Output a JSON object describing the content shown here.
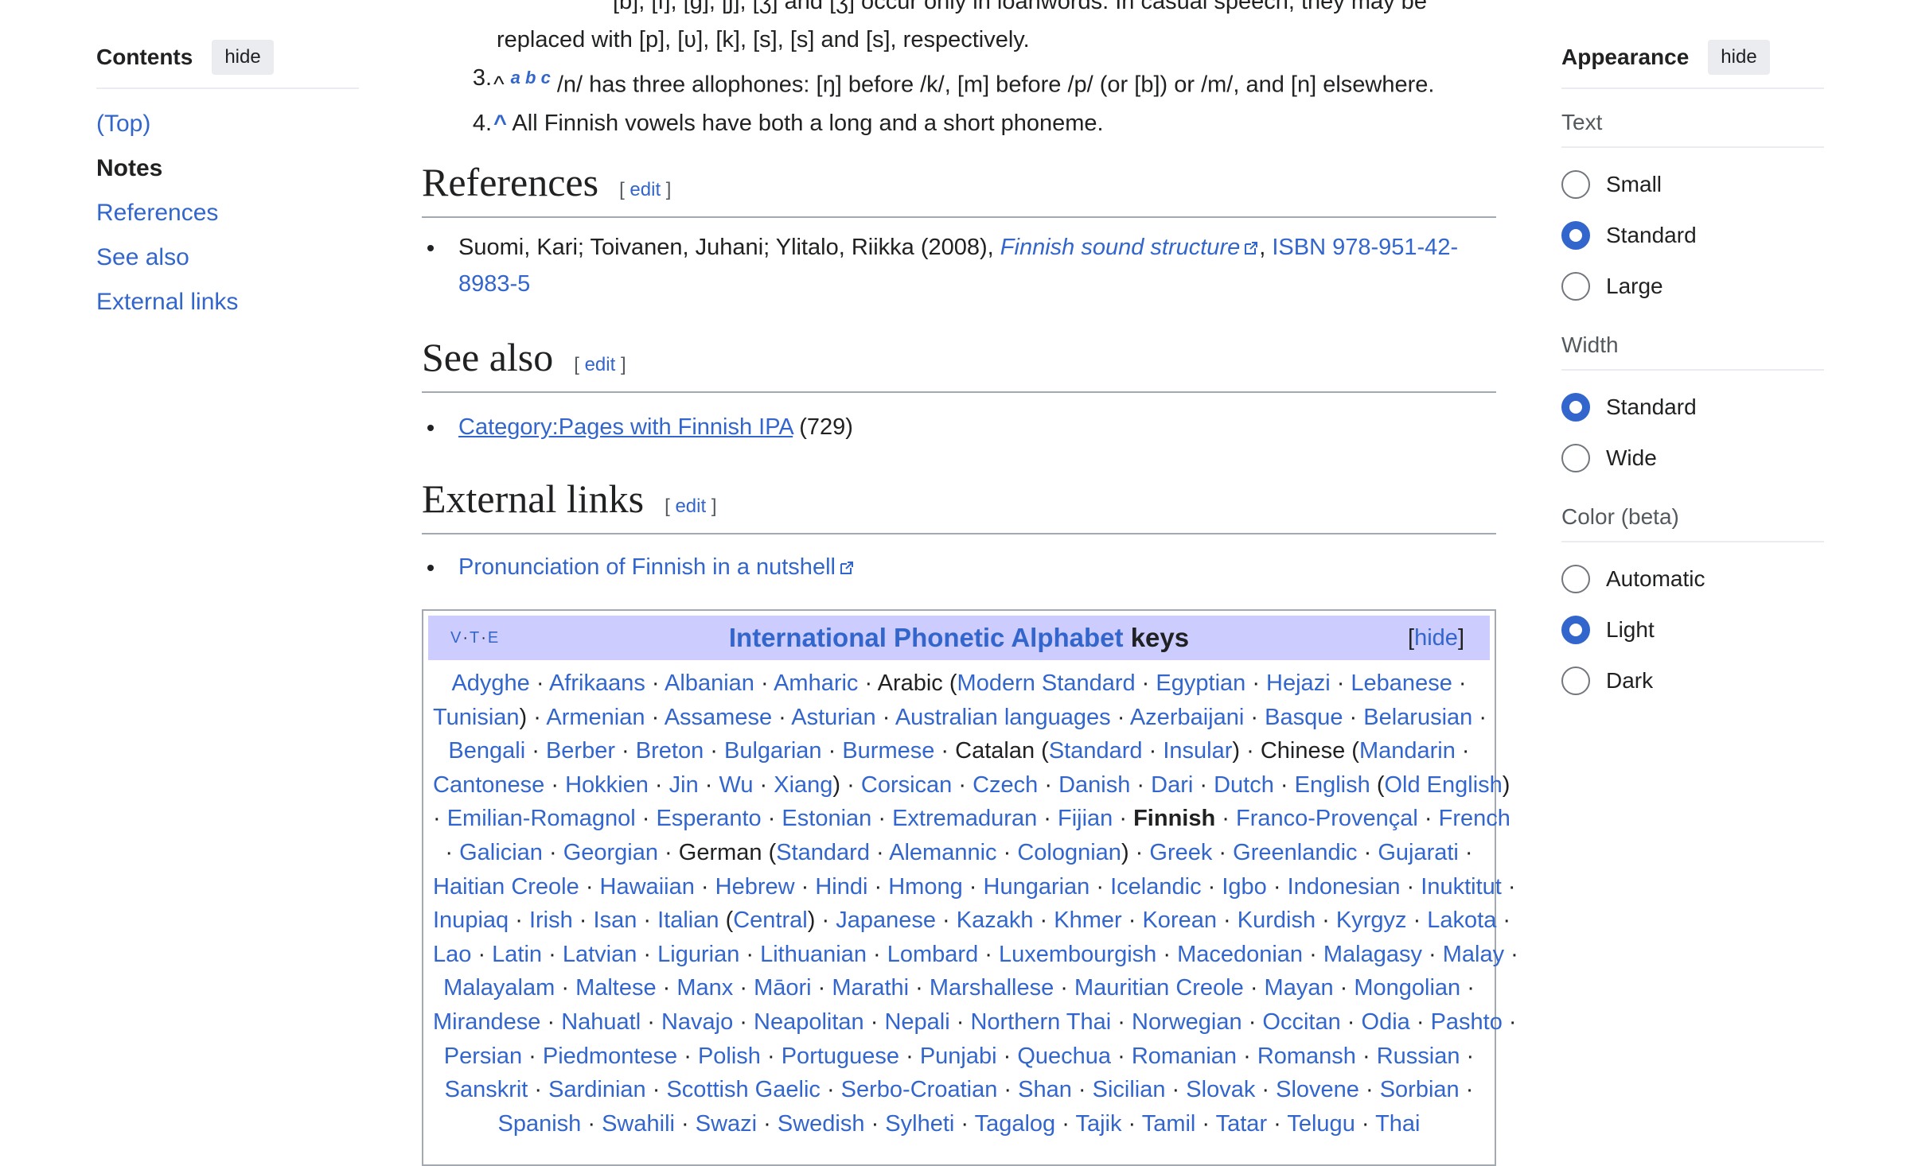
{
  "toc": {
    "title": "Contents",
    "hide_label": "hide",
    "items": [
      "(Top)",
      "Notes",
      "References",
      "See also",
      "External links"
    ]
  },
  "appearance": {
    "title": "Appearance",
    "hide_label": "hide",
    "text": {
      "label": "Text",
      "options": [
        "Small",
        "Standard",
        "Large"
      ],
      "selected": "Standard"
    },
    "width": {
      "label": "Width",
      "options": [
        "Standard",
        "Wide"
      ],
      "selected": "Standard"
    },
    "color": {
      "label": "Color (beta)",
      "options": [
        "Automatic",
        "Light",
        "Dark"
      ],
      "selected": "Light"
    }
  },
  "notes": {
    "partial_line_1": "[b], [f], [g], [ʃ], [ʒ] and [ʒ] occur only in loanwords. In casual speech, they may be",
    "partial_line_2": "replaced with [p], [ʋ], [k], [s], [s] and [s], respectively.",
    "note3": {
      "num": "3.",
      "caret": "^",
      "sup": "a b c",
      "text": "/n/ has three allophones: [ŋ] before /k/, [m] before /p/ (or [b]) or /m/, and [n] elsewhere."
    },
    "note4": {
      "num": "4.",
      "caret": "^",
      "text": "All Finnish vowels have both a long and a short phoneme."
    }
  },
  "sections": {
    "edit_label": "edit",
    "references": {
      "heading": "References",
      "authors": "Suomi, Kari; Toivanen, Juhani; Ylitalo, Riikka (2008),",
      "book": "Finnish sound structure",
      "isbn_line1": "ISBN 978-951-42-",
      "isbn_line2": "8983-5"
    },
    "see_also": {
      "heading": "See also",
      "link": "Category:Pages with Finnish IPA",
      "count": "(729)"
    },
    "external_links": {
      "heading": "External links",
      "link": "Pronunciation of Finnish in a nutshell"
    }
  },
  "navbox": {
    "vte": [
      "V",
      "T",
      "E"
    ],
    "title_link": "International Phonetic Alphabet",
    "title_rest": "keys",
    "hide_label": "hide",
    "lines": [
      [
        [
          "l",
          "Adyghe"
        ],
        [
          "s",
          " · "
        ],
        [
          "l",
          "Afrikaans"
        ],
        [
          "s",
          " · "
        ],
        [
          "l",
          "Albanian"
        ],
        [
          "s",
          " · "
        ],
        [
          "l",
          "Amharic"
        ],
        [
          "s",
          " · "
        ],
        [
          "p",
          "Arabic ("
        ],
        [
          "l",
          "Modern Standard"
        ],
        [
          "s",
          " · "
        ],
        [
          "l",
          "Egyptian"
        ],
        [
          "s",
          " · "
        ],
        [
          "l",
          "Hejazi"
        ],
        [
          "s",
          " · "
        ],
        [
          "l",
          "Lebanese"
        ],
        [
          "s",
          " ·"
        ]
      ],
      [
        [
          "l",
          "Tunisian"
        ],
        [
          "p",
          ")"
        ],
        [
          "s",
          " · "
        ],
        [
          "l",
          "Armenian"
        ],
        [
          "s",
          " · "
        ],
        [
          "l",
          "Assamese"
        ],
        [
          "s",
          " · "
        ],
        [
          "l",
          "Asturian"
        ],
        [
          "s",
          " · "
        ],
        [
          "l",
          "Australian languages"
        ],
        [
          "s",
          " · "
        ],
        [
          "l",
          "Azerbaijani"
        ],
        [
          "s",
          " · "
        ],
        [
          "l",
          "Basque"
        ],
        [
          "s",
          " · "
        ],
        [
          "l",
          "Belarusian"
        ],
        [
          "s",
          " ·"
        ]
      ],
      [
        [
          "l",
          "Bengali"
        ],
        [
          "s",
          " · "
        ],
        [
          "l",
          "Berber"
        ],
        [
          "s",
          " · "
        ],
        [
          "l",
          "Breton"
        ],
        [
          "s",
          " · "
        ],
        [
          "l",
          "Bulgarian"
        ],
        [
          "s",
          " · "
        ],
        [
          "l",
          "Burmese"
        ],
        [
          "s",
          " · "
        ],
        [
          "p",
          "Catalan ("
        ],
        [
          "l",
          "Standard"
        ],
        [
          "s",
          " · "
        ],
        [
          "l",
          "Insular"
        ],
        [
          "p",
          ")"
        ],
        [
          "s",
          " · "
        ],
        [
          "p",
          "Chinese ("
        ],
        [
          "l",
          "Mandarin"
        ],
        [
          "s",
          " ·"
        ]
      ],
      [
        [
          "l",
          "Cantonese"
        ],
        [
          "s",
          " · "
        ],
        [
          "l",
          "Hokkien"
        ],
        [
          "s",
          " · "
        ],
        [
          "l",
          "Jin"
        ],
        [
          "s",
          " · "
        ],
        [
          "l",
          "Wu"
        ],
        [
          "s",
          " · "
        ],
        [
          "l",
          "Xiang"
        ],
        [
          "p",
          ")"
        ],
        [
          "s",
          " · "
        ],
        [
          "l",
          "Corsican"
        ],
        [
          "s",
          " · "
        ],
        [
          "l",
          "Czech"
        ],
        [
          "s",
          " · "
        ],
        [
          "l",
          "Danish"
        ],
        [
          "s",
          " · "
        ],
        [
          "l",
          "Dari"
        ],
        [
          "s",
          " · "
        ],
        [
          "l",
          "Dutch"
        ],
        [
          "s",
          " · "
        ],
        [
          "l",
          "English"
        ],
        [
          "p",
          " ("
        ],
        [
          "l",
          "Old English"
        ],
        [
          "p",
          ")"
        ]
      ],
      [
        [
          "s",
          "· "
        ],
        [
          "l",
          "Emilian-Romagnol"
        ],
        [
          "s",
          " · "
        ],
        [
          "l",
          "Esperanto"
        ],
        [
          "s",
          " · "
        ],
        [
          "l",
          "Estonian"
        ],
        [
          "s",
          " · "
        ],
        [
          "l",
          "Extremaduran"
        ],
        [
          "s",
          " · "
        ],
        [
          "l",
          "Fijian"
        ],
        [
          "s",
          " · "
        ],
        [
          "b",
          "Finnish"
        ],
        [
          "s",
          " · "
        ],
        [
          "l",
          "Franco-Provençal"
        ],
        [
          "s",
          " · "
        ],
        [
          "l",
          "French"
        ]
      ],
      [
        [
          "s",
          "· "
        ],
        [
          "l",
          "Galician"
        ],
        [
          "s",
          " · "
        ],
        [
          "l",
          "Georgian"
        ],
        [
          "s",
          " · "
        ],
        [
          "p",
          "German ("
        ],
        [
          "l",
          "Standard"
        ],
        [
          "s",
          " · "
        ],
        [
          "l",
          "Alemannic"
        ],
        [
          "s",
          " · "
        ],
        [
          "l",
          "Colognian"
        ],
        [
          "p",
          ")"
        ],
        [
          "s",
          " · "
        ],
        [
          "l",
          "Greek"
        ],
        [
          "s",
          " · "
        ],
        [
          "l",
          "Greenlandic"
        ],
        [
          "s",
          " · "
        ],
        [
          "l",
          "Gujarati"
        ],
        [
          "s",
          " ·"
        ]
      ],
      [
        [
          "l",
          "Haitian Creole"
        ],
        [
          "s",
          " · "
        ],
        [
          "l",
          "Hawaiian"
        ],
        [
          "s",
          " · "
        ],
        [
          "l",
          "Hebrew"
        ],
        [
          "s",
          " · "
        ],
        [
          "l",
          "Hindi"
        ],
        [
          "s",
          " · "
        ],
        [
          "l",
          "Hmong"
        ],
        [
          "s",
          " · "
        ],
        [
          "l",
          "Hungarian"
        ],
        [
          "s",
          " · "
        ],
        [
          "l",
          "Icelandic"
        ],
        [
          "s",
          " · "
        ],
        [
          "l",
          "Igbo"
        ],
        [
          "s",
          " · "
        ],
        [
          "l",
          "Indonesian"
        ],
        [
          "s",
          " · "
        ],
        [
          "l",
          "Inuktitut"
        ],
        [
          "s",
          " ·"
        ]
      ],
      [
        [
          "l",
          "Inupiaq"
        ],
        [
          "s",
          " · "
        ],
        [
          "l",
          "Irish"
        ],
        [
          "s",
          " · "
        ],
        [
          "l",
          "Isan"
        ],
        [
          "s",
          " · "
        ],
        [
          "l",
          "Italian"
        ],
        [
          "p",
          " ("
        ],
        [
          "l",
          "Central"
        ],
        [
          "p",
          ")"
        ],
        [
          "s",
          " · "
        ],
        [
          "l",
          "Japanese"
        ],
        [
          "s",
          " · "
        ],
        [
          "l",
          "Kazakh"
        ],
        [
          "s",
          " · "
        ],
        [
          "l",
          "Khmer"
        ],
        [
          "s",
          " · "
        ],
        [
          "l",
          "Korean"
        ],
        [
          "s",
          " · "
        ],
        [
          "l",
          "Kurdish"
        ],
        [
          "s",
          " · "
        ],
        [
          "l",
          "Kyrgyz"
        ],
        [
          "s",
          " · "
        ],
        [
          "l",
          "Lakota"
        ],
        [
          "s",
          " ·"
        ]
      ],
      [
        [
          "l",
          "Lao"
        ],
        [
          "s",
          " · "
        ],
        [
          "l",
          "Latin"
        ],
        [
          "s",
          " · "
        ],
        [
          "l",
          "Latvian"
        ],
        [
          "s",
          " · "
        ],
        [
          "l",
          "Ligurian"
        ],
        [
          "s",
          " · "
        ],
        [
          "l",
          "Lithuanian"
        ],
        [
          "s",
          " · "
        ],
        [
          "l",
          "Lombard"
        ],
        [
          "s",
          " · "
        ],
        [
          "l",
          "Luxembourgish"
        ],
        [
          "s",
          " · "
        ],
        [
          "l",
          "Macedonian"
        ],
        [
          "s",
          " · "
        ],
        [
          "l",
          "Malagasy"
        ],
        [
          "s",
          " · "
        ],
        [
          "l",
          "Malay"
        ],
        [
          "s",
          " ·"
        ]
      ],
      [
        [
          "l",
          "Malayalam"
        ],
        [
          "s",
          " · "
        ],
        [
          "l",
          "Maltese"
        ],
        [
          "s",
          " · "
        ],
        [
          "l",
          "Manx"
        ],
        [
          "s",
          " · "
        ],
        [
          "l",
          "Māori"
        ],
        [
          "s",
          " · "
        ],
        [
          "l",
          "Marathi"
        ],
        [
          "s",
          " · "
        ],
        [
          "l",
          "Marshallese"
        ],
        [
          "s",
          " · "
        ],
        [
          "l",
          "Mauritian Creole"
        ],
        [
          "s",
          " · "
        ],
        [
          "l",
          "Mayan"
        ],
        [
          "s",
          " · "
        ],
        [
          "l",
          "Mongolian"
        ],
        [
          "s",
          " ·"
        ]
      ],
      [
        [
          "l",
          "Mirandese"
        ],
        [
          "s",
          " · "
        ],
        [
          "l",
          "Nahuatl"
        ],
        [
          "s",
          " · "
        ],
        [
          "l",
          "Navajo"
        ],
        [
          "s",
          " · "
        ],
        [
          "l",
          "Neapolitan"
        ],
        [
          "s",
          " · "
        ],
        [
          "l",
          "Nepali"
        ],
        [
          "s",
          " · "
        ],
        [
          "l",
          "Northern Thai"
        ],
        [
          "s",
          " · "
        ],
        [
          "l",
          "Norwegian"
        ],
        [
          "s",
          " · "
        ],
        [
          "l",
          "Occitan"
        ],
        [
          "s",
          " · "
        ],
        [
          "l",
          "Odia"
        ],
        [
          "s",
          " · "
        ],
        [
          "l",
          "Pashto"
        ],
        [
          "s",
          " ·"
        ]
      ],
      [
        [
          "l",
          "Persian"
        ],
        [
          "s",
          " · "
        ],
        [
          "l",
          "Piedmontese"
        ],
        [
          "s",
          " · "
        ],
        [
          "l",
          "Polish"
        ],
        [
          "s",
          " · "
        ],
        [
          "l",
          "Portuguese"
        ],
        [
          "s",
          " · "
        ],
        [
          "l",
          "Punjabi"
        ],
        [
          "s",
          " · "
        ],
        [
          "l",
          "Quechua"
        ],
        [
          "s",
          " · "
        ],
        [
          "l",
          "Romanian"
        ],
        [
          "s",
          " · "
        ],
        [
          "l",
          "Romansh"
        ],
        [
          "s",
          " · "
        ],
        [
          "l",
          "Russian"
        ],
        [
          "s",
          " ·"
        ]
      ],
      [
        [
          "l",
          "Sanskrit"
        ],
        [
          "s",
          " · "
        ],
        [
          "l",
          "Sardinian"
        ],
        [
          "s",
          " · "
        ],
        [
          "l",
          "Scottish Gaelic"
        ],
        [
          "s",
          " · "
        ],
        [
          "l",
          "Serbo-Croatian"
        ],
        [
          "s",
          " · "
        ],
        [
          "l",
          "Shan"
        ],
        [
          "s",
          " · "
        ],
        [
          "l",
          "Sicilian"
        ],
        [
          "s",
          " · "
        ],
        [
          "l",
          "Slovak"
        ],
        [
          "s",
          " · "
        ],
        [
          "l",
          "Slovene"
        ],
        [
          "s",
          " · "
        ],
        [
          "l",
          "Sorbian"
        ],
        [
          "s",
          " ·"
        ]
      ],
      [
        [
          "l",
          "Spanish"
        ],
        [
          "s",
          " · "
        ],
        [
          "l",
          "Swahili"
        ],
        [
          "s",
          " · "
        ],
        [
          "l",
          "Swazi"
        ],
        [
          "s",
          " · "
        ],
        [
          "l",
          "Swedish"
        ],
        [
          "s",
          " · "
        ],
        [
          "l",
          "Sylheti"
        ],
        [
          "s",
          " · "
        ],
        [
          "l",
          "Tagalog"
        ],
        [
          "s",
          " · "
        ],
        [
          "l",
          "Tajik"
        ],
        [
          "s",
          " · "
        ],
        [
          "l",
          "Tamil"
        ],
        [
          "s",
          " · "
        ],
        [
          "l",
          "Tatar"
        ],
        [
          "s",
          " · "
        ],
        [
          "l",
          "Telugu"
        ],
        [
          "s",
          " · "
        ],
        [
          "l",
          "Thai"
        ]
      ]
    ]
  },
  "colors": {
    "link": "#3366cc",
    "navbox_title_bg": "#ccccff",
    "radio_selected": "#3366cc"
  }
}
